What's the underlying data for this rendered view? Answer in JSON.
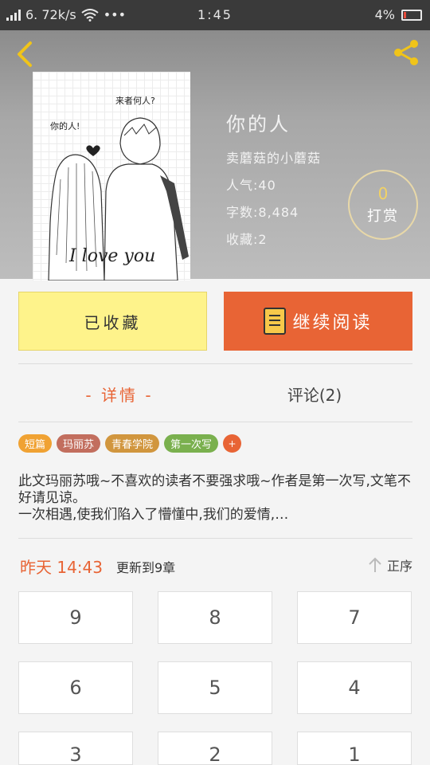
{
  "status_bar": {
    "speed": "6. 72k/s",
    "dots": "•••",
    "time": "1:45",
    "battery": "4%"
  },
  "header": {
    "cover_caption_top": "来者何人?",
    "cover_caption_left": "你的人!",
    "cover_signature": "I love you"
  },
  "book": {
    "title": "你的人",
    "author": "卖蘑菇的小蘑菇",
    "popularity": "人气:40",
    "word_count": "字数:8,484",
    "favorites": "收藏:2"
  },
  "tip": {
    "count": "0",
    "label": "打赏"
  },
  "actions": {
    "collected_label": "已收藏",
    "read_label": "继续阅读"
  },
  "tabs": {
    "details": "- 详情 -",
    "comments": "评论(2)"
  },
  "tags": [
    {
      "label": "短篇",
      "color": "#f0a233"
    },
    {
      "label": "玛丽苏",
      "color": "#c26e5e"
    },
    {
      "label": "青春学院",
      "color": "#d1963e"
    },
    {
      "label": "第一次写",
      "color": "#7ab04e"
    }
  ],
  "tag_add": "+",
  "description": "此文玛丽苏哦~不喜欢的读者不要强求哦~作者是第一次写,文笔不好请见谅。\n一次相遇,使我们陷入了懵懂中,我们的爱情,…",
  "update": {
    "time": "昨天 14:43",
    "text": "更新到9章",
    "sort_label": "正序"
  },
  "chapters": [
    "9",
    "8",
    "7",
    "6",
    "5",
    "4",
    "3",
    "2",
    "1"
  ],
  "colors": {
    "accent": "#e86435",
    "collected_bg": "#fef38b",
    "tip_count": "#f2d264"
  }
}
